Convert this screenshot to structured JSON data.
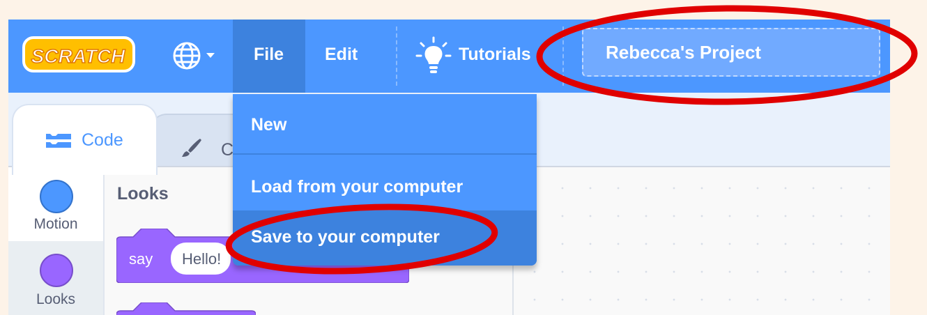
{
  "menubar": {
    "logo_text": "SCRATCH",
    "file_label": "File",
    "edit_label": "Edit",
    "tutorials_label": "Tutorials",
    "project_title": "Rebecca's Project"
  },
  "file_menu": {
    "items": [
      {
        "label": "New"
      },
      {
        "label": "Load from your computer"
      },
      {
        "label": "Save to your computer"
      }
    ]
  },
  "tabs": {
    "code_label": "Code",
    "costumes_label": "C"
  },
  "categories": [
    {
      "label": "Motion",
      "color": "#4c97ff"
    },
    {
      "label": "Looks",
      "color": "#9966ff"
    }
  ],
  "palette": {
    "heading": "Looks",
    "say_block": {
      "keyword": "say",
      "value": "Hello!"
    }
  },
  "colors": {
    "menubar": "#4c97ff",
    "menu_active": "#3d82de",
    "looks_block": "#9966ff",
    "annotation": "#e00000"
  }
}
